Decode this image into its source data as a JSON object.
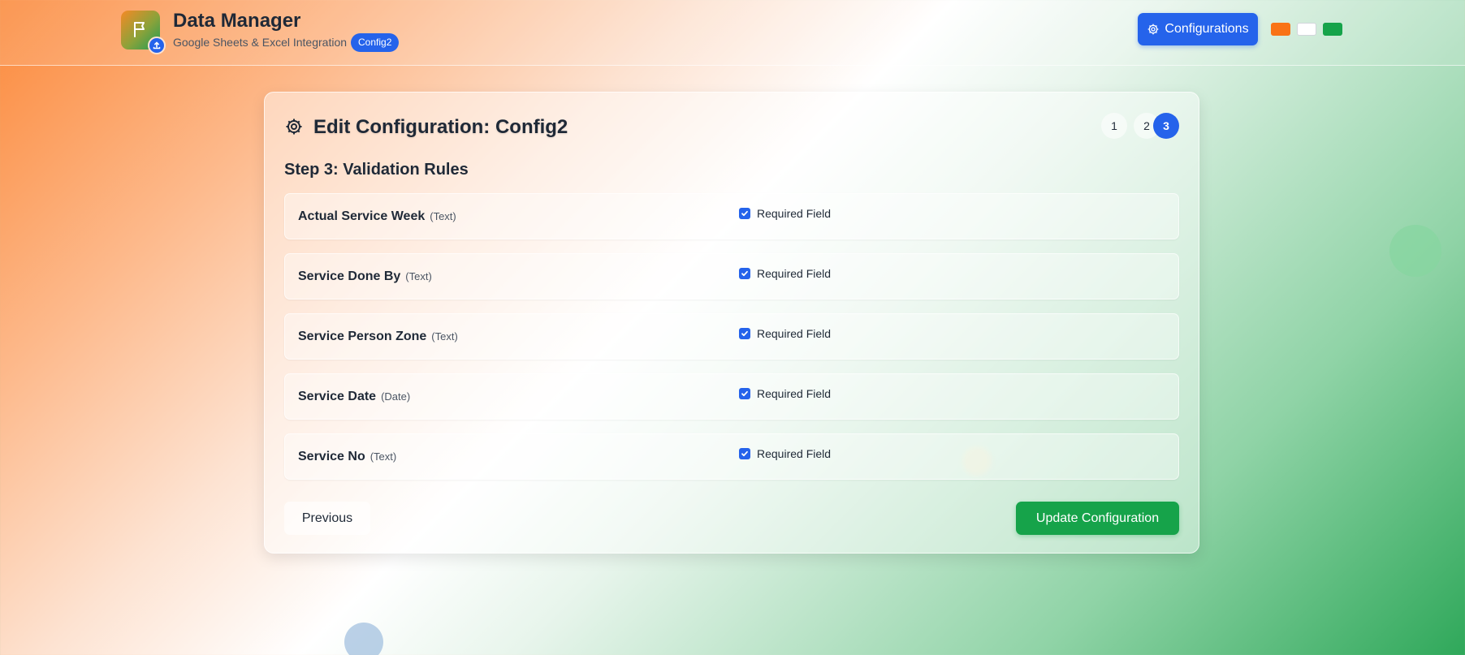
{
  "header": {
    "app_title": "Data Manager",
    "app_subtitle": "Google Sheets & Excel Integration",
    "config_badge": "Config2",
    "configurations_button": "Configurations",
    "logo_icon": "flag-icon",
    "logo_badge_icon": "upload-icon",
    "theme_swatches": [
      "#f97316",
      "#ffffff",
      "#16a34a"
    ]
  },
  "card": {
    "title": "Edit Configuration: Config2",
    "title_icon": "gear-icon",
    "steps": [
      "1",
      "2",
      "3"
    ],
    "active_step": "3",
    "step_heading": "Step 3: Validation Rules",
    "fields": [
      {
        "name": "Actual Service Week",
        "type": "(Text)",
        "required_label": "Required Field",
        "required": true
      },
      {
        "name": "Service Done By",
        "type": "(Text)",
        "required_label": "Required Field",
        "required": true
      },
      {
        "name": "Service Person Zone",
        "type": "(Text)",
        "required_label": "Required Field",
        "required": true
      },
      {
        "name": "Service Date",
        "type": "(Date)",
        "required_label": "Required Field",
        "required": true
      },
      {
        "name": "Service No",
        "type": "(Text)",
        "required_label": "Required Field",
        "required": true
      }
    ],
    "previous_button": "Previous",
    "update_button": "Update Configuration"
  },
  "colors": {
    "primary_blue": "#2563eb",
    "success_green": "#16a34a",
    "accent_orange": "#f97316"
  }
}
